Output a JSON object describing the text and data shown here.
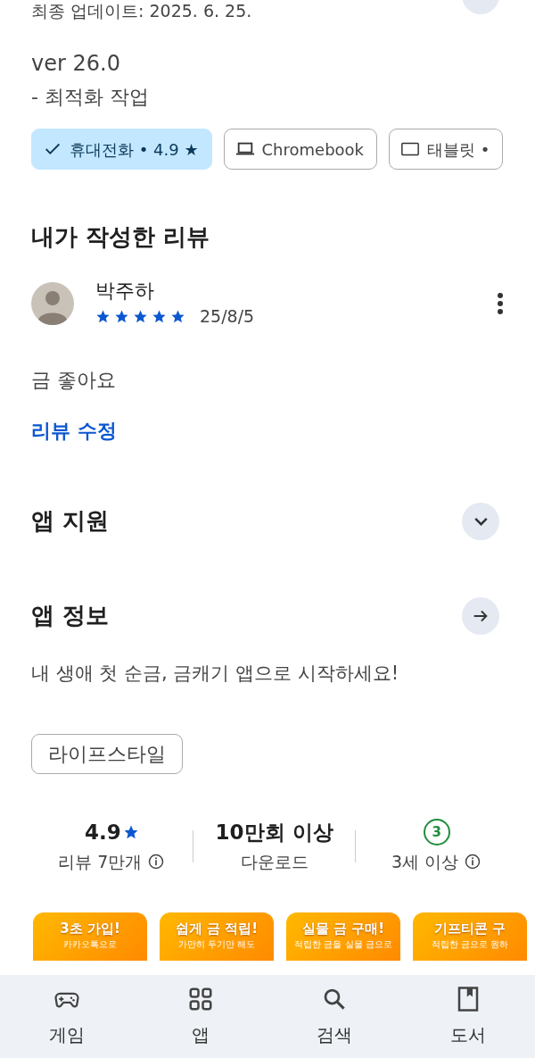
{
  "update": {
    "date_line": "최종 업데이트: 2025. 6. 25.",
    "version": "ver 26.0",
    "notes": "- 최적화 작업"
  },
  "device_chips": [
    {
      "label": "휴대전화 • 4.9 ★",
      "kind": "phone",
      "selected": true
    },
    {
      "label": "Chromebook",
      "kind": "laptop",
      "selected": false
    },
    {
      "label": "태블릿 •",
      "kind": "tablet",
      "selected": false
    }
  ],
  "my_review": {
    "heading": "내가 작성한 리뷰",
    "reviewer": "박주하",
    "stars": 5,
    "date": "25/8/5",
    "text": "금 좋아요",
    "edit_link": "리뷰 수정"
  },
  "sections": [
    {
      "title": "앱 지원",
      "kind": "expand"
    },
    {
      "title": "앱 정보",
      "kind": "arrow"
    }
  ],
  "description": "내 생애 첫 순금, 금캐기 앱으로 시작하세요!",
  "category_chip": "라이프스타일",
  "stats": [
    {
      "kind": "rating",
      "value": "4.9",
      "label": "리뷰 7만개",
      "info": true
    },
    {
      "kind": "text",
      "value": "10만회 이상",
      "label": "다운로드",
      "info": false
    },
    {
      "kind": "age",
      "value": "3",
      "label": "3세 이상",
      "info": true
    }
  ],
  "screenshots": [
    {
      "title": "3초 가입!",
      "subtitle": "카카오톡으로"
    },
    {
      "title": "쉽게 금 적립!",
      "subtitle": "가만히 두기만 해도"
    },
    {
      "title": "실물 금 구매!",
      "subtitle": "적립한 금을 실물 금으로"
    },
    {
      "title": "기프티콘 구",
      "subtitle": "적립한 금으로 원하"
    }
  ],
  "bottom_nav": [
    {
      "label": "게임",
      "kind": "games"
    },
    {
      "label": "앱",
      "kind": "apps"
    },
    {
      "label": "검색",
      "kind": "search"
    },
    {
      "label": "도서",
      "kind": "books"
    }
  ]
}
